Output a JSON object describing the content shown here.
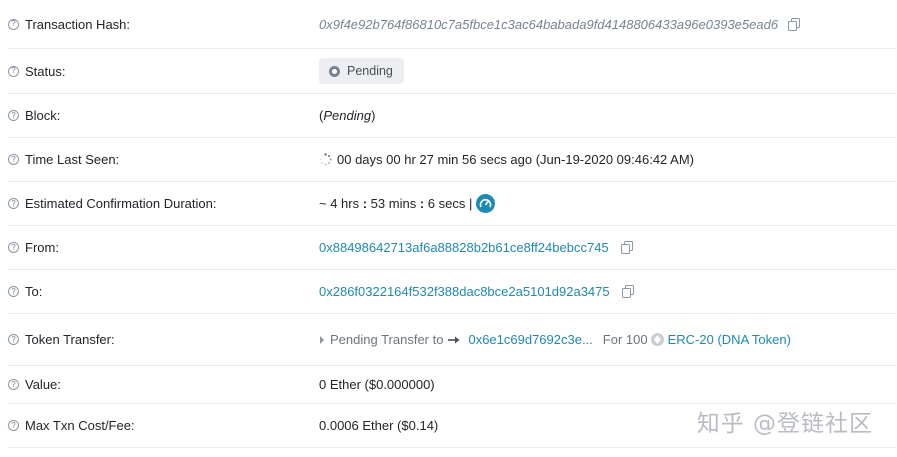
{
  "rows": [
    {
      "label": "Transaction Hash:",
      "value": "0x9f4e92b764f86810c7a5fbce1c3ac64babada9fd4148806433a96e0393e5ead6"
    },
    {
      "label": "Status:",
      "value": "Pending"
    },
    {
      "label": "Block:",
      "value_open": "(",
      "value_italic": "Pending",
      "value_close": ")"
    },
    {
      "label": "Time Last Seen:",
      "value": "00 days 00 hr 27 min 56 secs ago (Jun-19-2020 09:46:42 AM)"
    },
    {
      "label": "Estimated Confirmation Duration:",
      "value_prefix": "~ 4 hrs",
      "value_sep1": " : ",
      "value_mid": "53 mins",
      "value_sep2": " : ",
      "value_end": "6 secs |"
    },
    {
      "label": "From:",
      "value": "0x88498642713af6a88828b2b61ce8ff24bebcc745"
    },
    {
      "label": "To:",
      "value": "0x286f0322164f532f388dac8bce2a5101d92a3475"
    },
    {
      "label": "Token Transfer:",
      "pending_text": "Pending Transfer to",
      "to_address": "0x6e1c69d7692c3e...",
      "for_text": "For 100",
      "token_name": "ERC-20 (DNA Token)"
    },
    {
      "label": "Value:",
      "value": "0 Ether ($0.000000)"
    },
    {
      "label": "Max Txn Cost/Fee:",
      "value": "0.0006 Ether ($0.14)"
    }
  ],
  "help_glyph": "?",
  "watermark": "知乎 @登链社区",
  "colors": {
    "link": "#1e89b4",
    "badge_bg": "#eceef1",
    "border": "#e7eaf3"
  },
  "icons": [
    "question-icon",
    "copy-icon",
    "pending-dot-icon",
    "spinner-icon",
    "gauge-icon",
    "caret-right-icon",
    "arrow-right-icon",
    "token-coin-icon"
  ]
}
